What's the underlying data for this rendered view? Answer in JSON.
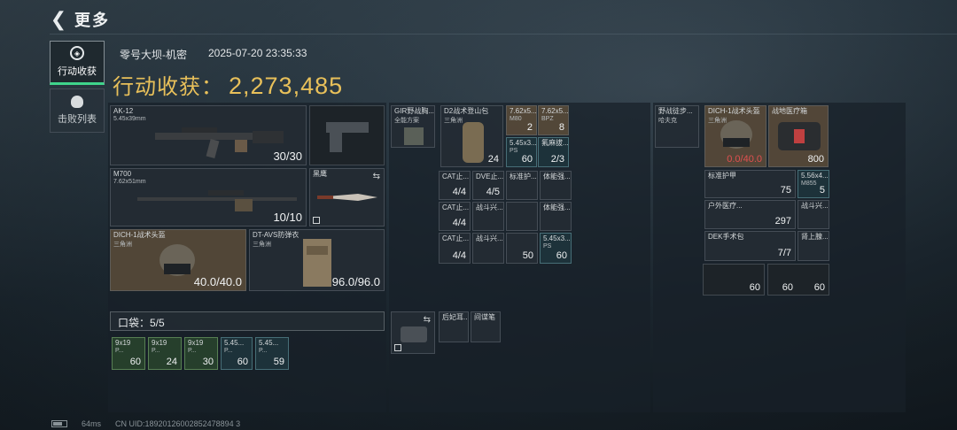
{
  "header": {
    "title": "更多",
    "back_icon": "back-chevron-icon"
  },
  "nav": [
    {
      "label": "行动收获",
      "icon": "target-icon",
      "active": true
    },
    {
      "label": "击败列表",
      "icon": "skull-icon",
      "active": false
    }
  ],
  "match": {
    "map": "零号大坝-机密",
    "datetime": "2025-07-20 23:35:33"
  },
  "harvest": {
    "label": "行动收获：",
    "value": "2,273,485"
  },
  "weapons": {
    "primary": {
      "name": "AK-12",
      "caliber": "5.45x39mm",
      "ammo": "30/30"
    },
    "secondary": {
      "name": "M700",
      "caliber": "7.62x51mm",
      "ammo": "10/10"
    },
    "melee": {
      "name": "黑鹰"
    }
  },
  "armor": {
    "helmet": {
      "name": "DICH-1战术头盔",
      "sub": "三角洲",
      "durability": "40.0/40.0"
    },
    "vest": {
      "name": "DT-AVS防弹衣",
      "sub": "三角洲",
      "durability": "96.0/96.0"
    }
  },
  "pocket": {
    "label": "口袋：5/5",
    "items": [
      {
        "name": "9x19",
        "sub": "P...",
        "count": "60"
      },
      {
        "name": "9x19",
        "sub": "P...",
        "count": "24"
      },
      {
        "name": "9x19",
        "sub": "P...",
        "count": "30"
      },
      {
        "name": "5.45...",
        "sub": "P...",
        "count": "60"
      },
      {
        "name": "5.45...",
        "sub": "P...",
        "count": "59"
      }
    ]
  },
  "chest_rig": {
    "name": "GIR野战胸...",
    "sub": "全能方案"
  },
  "backpack": {
    "name": "D2战术登山包",
    "sub": "三角洲",
    "count": "24"
  },
  "mid_items": {
    "a1": {
      "name": "7.62x5...",
      "sub": "M80",
      "count": "2"
    },
    "a2": {
      "name": "7.62x5...",
      "sub": "BPZ",
      "count": "8"
    },
    "a3": {
      "name": "5.45x3...",
      "sub": "PS",
      "count": "60"
    },
    "a4": {
      "name": "氟麻拔...",
      "count": "2/3"
    },
    "b1": {
      "name": "CAT止...",
      "count": "4/4"
    },
    "b2": {
      "name": "DVE止...",
      "count": "4/5"
    },
    "b3": {
      "name": "标准护..."
    },
    "b4": {
      "name": "体能强..."
    },
    "c1": {
      "name": "CAT止...",
      "count": "4/4"
    },
    "c2": {
      "name": "战斗兴..."
    },
    "c4": {
      "name": "体能强..."
    },
    "d1": {
      "name": "CAT止...",
      "count": "4/4"
    },
    "d2": {
      "name": "战斗兴..."
    },
    "d3": {
      "count": "50"
    },
    "d4": {
      "name": "5.45x3...",
      "sub": "PS",
      "count": "60"
    }
  },
  "secure": {
    "i2": {
      "name": "后妃耳..."
    },
    "i3": {
      "name": "间谍笔"
    }
  },
  "right": {
    "rig": {
      "name": "野战徒步...",
      "sub": "哈夫克"
    },
    "helmet": {
      "name": "DICH-1战术头盔",
      "sub": "三角洲",
      "durability": "0.0/40.0"
    },
    "medkit": {
      "name": "战地医疗箱",
      "count": "800"
    },
    "armor_plate": {
      "name": "标准护甲",
      "count": "75"
    },
    "ammo": {
      "name": "5.56x4...",
      "sub": "M855",
      "count": "5"
    },
    "outdoor_kit": {
      "name": "户外医疗...",
      "count": "297"
    },
    "stim": {
      "name": "战斗兴..."
    },
    "dek": {
      "name": "DEK手术包",
      "count": "7/7"
    },
    "adrenaline": {
      "name": "肾上腺..."
    },
    "r1": {
      "count": "60"
    },
    "r2": {
      "count": "60"
    },
    "r3": {
      "count": "60"
    }
  },
  "status": {
    "ping": "64ms",
    "uid": "CN UID:18920126002852478894 3"
  }
}
